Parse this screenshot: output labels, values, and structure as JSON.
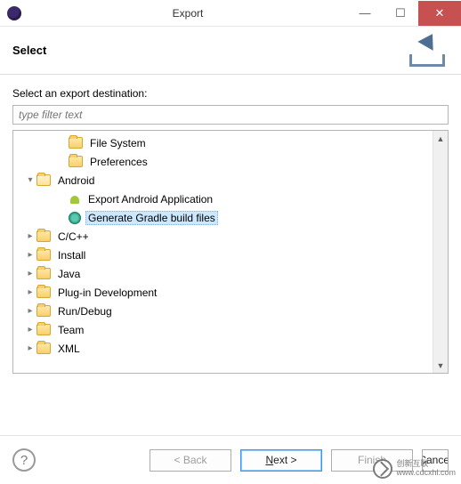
{
  "window": {
    "title": "Export"
  },
  "header": {
    "title": "Select"
  },
  "wizard": {
    "label": "Select an export destination:",
    "filter_placeholder": "type filter text"
  },
  "tree": {
    "items": [
      {
        "label": "File System",
        "type": "folder",
        "level": 2,
        "expander": ""
      },
      {
        "label": "Preferences",
        "type": "folder",
        "level": 2,
        "expander": ""
      },
      {
        "label": "Android",
        "type": "folder-open",
        "level": 1,
        "expander": "▾"
      },
      {
        "label": "Export Android Application",
        "type": "android",
        "level": 2,
        "expander": ""
      },
      {
        "label": "Generate Gradle build files",
        "type": "gradle",
        "level": 2,
        "expander": "",
        "selected": true
      },
      {
        "label": "C/C++",
        "type": "folder",
        "level": 1,
        "expander": "▸"
      },
      {
        "label": "Install",
        "type": "folder",
        "level": 1,
        "expander": "▸"
      },
      {
        "label": "Java",
        "type": "folder",
        "level": 1,
        "expander": "▸"
      },
      {
        "label": "Plug-in Development",
        "type": "folder",
        "level": 1,
        "expander": "▸"
      },
      {
        "label": "Run/Debug",
        "type": "folder",
        "level": 1,
        "expander": "▸"
      },
      {
        "label": "Team",
        "type": "folder",
        "level": 1,
        "expander": "▸"
      },
      {
        "label": "XML",
        "type": "folder",
        "level": 1,
        "expander": "▸"
      }
    ]
  },
  "buttons": {
    "back": "< Back",
    "next_prefix": "N",
    "next_suffix": "ext >",
    "finish": "Finish",
    "cancel": "Cancel"
  },
  "watermark": {
    "line1": "创新互联",
    "line2": "www.cdcxhl.com"
  }
}
